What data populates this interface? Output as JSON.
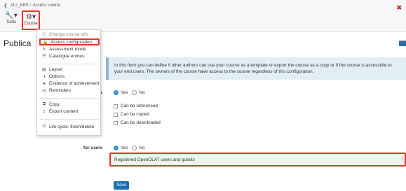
{
  "breadcrumb": {
    "course": "ALL_KBS",
    "page": "Access control"
  },
  "toolbar": {
    "tools_label": "Tools",
    "course_label": "Course"
  },
  "page": {
    "title": "Publica"
  },
  "info_text": "In this form you can define if other authors can use your course as a template or export the course as a copy or if the course is accessible to your end users. The owners of the course have access to the course regardless of this configuration.",
  "authors_section": {
    "label_fragment": "rs",
    "yes_label": "Yes",
    "no_label": "No",
    "selected": "Yes",
    "checkboxes": [
      "Can be referenced",
      "Can be copied",
      "Can be downloaded"
    ]
  },
  "users_section": {
    "label": "for users",
    "yes_label": "Yes",
    "no_label": "No",
    "selected": "Yes",
    "select_value": "Registered OpenOLAT users and guests"
  },
  "save_label": "Save",
  "course_menu": {
    "items": [
      {
        "icon": "info-icon",
        "label": "Change course info"
      },
      {
        "icon": "lock-icon",
        "label": "Access configuration",
        "highlighted": true
      },
      {
        "icon": "pencil-icon",
        "label": "Assessment mode"
      },
      {
        "icon": "sitemap-icon",
        "label": "Catalogue entries"
      },
      {
        "icon": "layout-icon",
        "label": "Layout"
      },
      {
        "icon": "toggle-icon",
        "label": "Options"
      },
      {
        "icon": "circle-icon",
        "label": "Evidence of achievement"
      },
      {
        "icon": "bell-icon",
        "label": "Reminders"
      },
      {
        "icon": "copy-icon",
        "label": "Copy"
      },
      {
        "icon": "download-icon",
        "label": "Export content"
      },
      {
        "icon": "power-icon",
        "label": "Life cycle: finish/delete"
      }
    ]
  },
  "colors": {
    "highlight": "#e53425",
    "primary": "#1a6fb5",
    "radio_on": "#2d8fd5",
    "info_bg": "#e2eef6"
  }
}
